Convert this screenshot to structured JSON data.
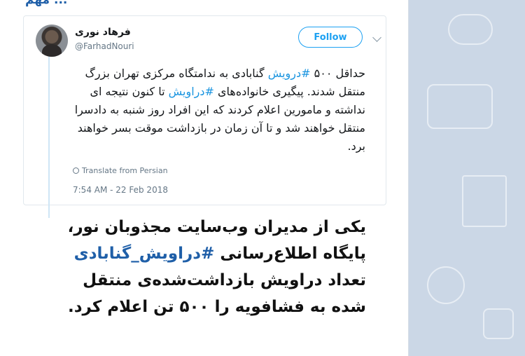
{
  "message": {
    "top_fragment": "... مهم"
  },
  "tweet": {
    "author_name": "فرهاد نوری",
    "author_handle": "@FarhadNouri",
    "follow_label": "Follow",
    "text_before_1": "حداقل ۵۰۰ ",
    "hashtag_1": "#درویش",
    "text_after_1": " گنابادی به ندامتگاه مرکزی تهران بزرگ منتقل شدند. پیگیری خانواده‌های ",
    "hashtag_2": "#دراویش",
    "text_after_2": " تا کنون نتیجه ای نداشته و مامورین اعلام کردند که این افراد روز شنبه به دادسرا منتقل خواهند شد و تا آن زمان در بازداشت موقت بسر خواهند برد.",
    "translate_label": "Translate from Persian",
    "timestamp": "7:54 AM - 22 Feb 2018"
  },
  "caption": {
    "line_1": "یکی از مدیران وب‌سایت مجذوبان نور،",
    "line_2_before": "پایگاه اطلاع‌رسانی ",
    "line_2_hashtag": "#دراویش_گنابادی",
    "line_3": "تعداد دراویش بازداشت‌شده‌ی منتقل",
    "line_4": "شده به فشافویه را ۵۰۰ تن اعلام کرد."
  },
  "colors": {
    "background": "#cbd7e6",
    "hashtag_tweet": "#1b95e0",
    "hashtag_caption": "#1f5fa8",
    "follow_accent": "#1da1f2"
  },
  "icons": {
    "chevron": "chevron-down-icon",
    "globe": "globe-icon"
  }
}
